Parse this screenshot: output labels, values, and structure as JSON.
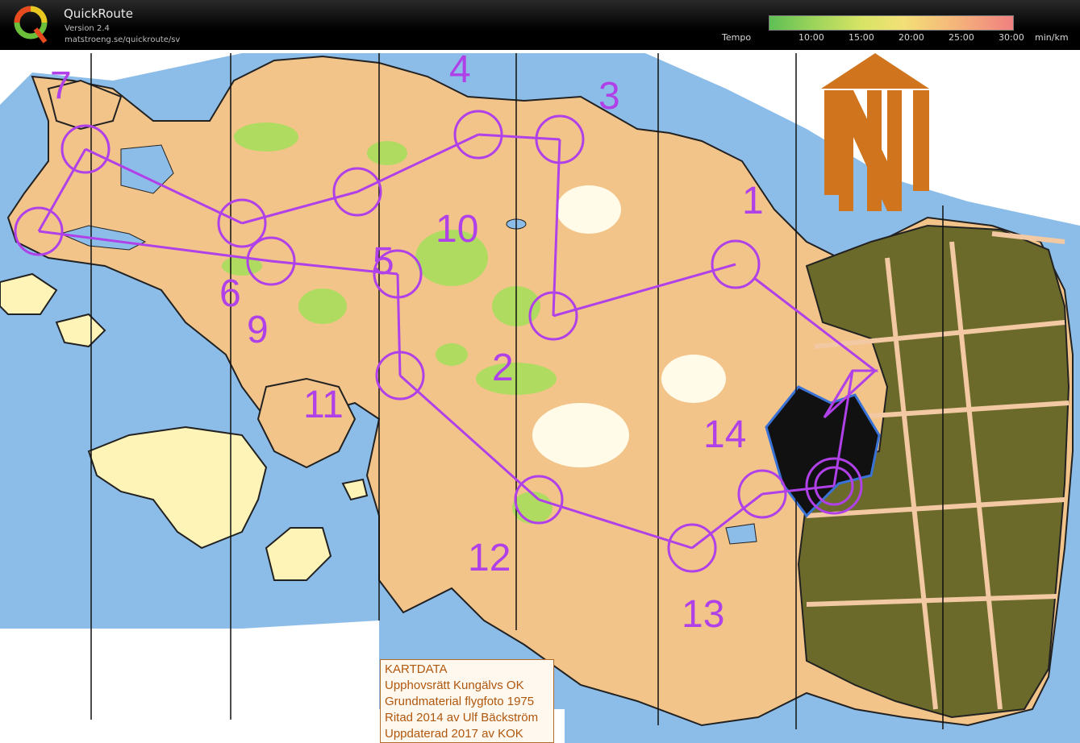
{
  "app": {
    "title": "QuickRoute",
    "version": "Version 2.4",
    "url": "matstroeng.se/quickroute/sv"
  },
  "tempo": {
    "label": "Tempo",
    "ticks": [
      "10:00",
      "15:00",
      "20:00",
      "25:00",
      "30:00"
    ],
    "unit": "min/km",
    "colors": [
      "#5fbf55",
      "#d8e465",
      "#f3e078",
      "#f5b87a",
      "#f08080"
    ]
  },
  "course": {
    "color": "#b040e8",
    "controls": [
      "1",
      "2",
      "3",
      "4",
      "5",
      "6",
      "7",
      "9",
      "10",
      "11",
      "12",
      "13",
      "14"
    ]
  },
  "credit": {
    "lines": [
      "KARTDATA",
      "Upphovsrätt Kungälvs OK",
      "Grundmaterial flygfoto 1975",
      "Ritad 2014 av Ulf Bäckström",
      "Uppdaterad 2017 av KOK"
    ]
  },
  "colors": {
    "water": "#8cbce8",
    "land": "#f2c48a",
    "open": "#fff4b8",
    "forest_green": "#a8de5c",
    "urban": "#6b6a2a",
    "north_arrow": "#d0741e"
  }
}
